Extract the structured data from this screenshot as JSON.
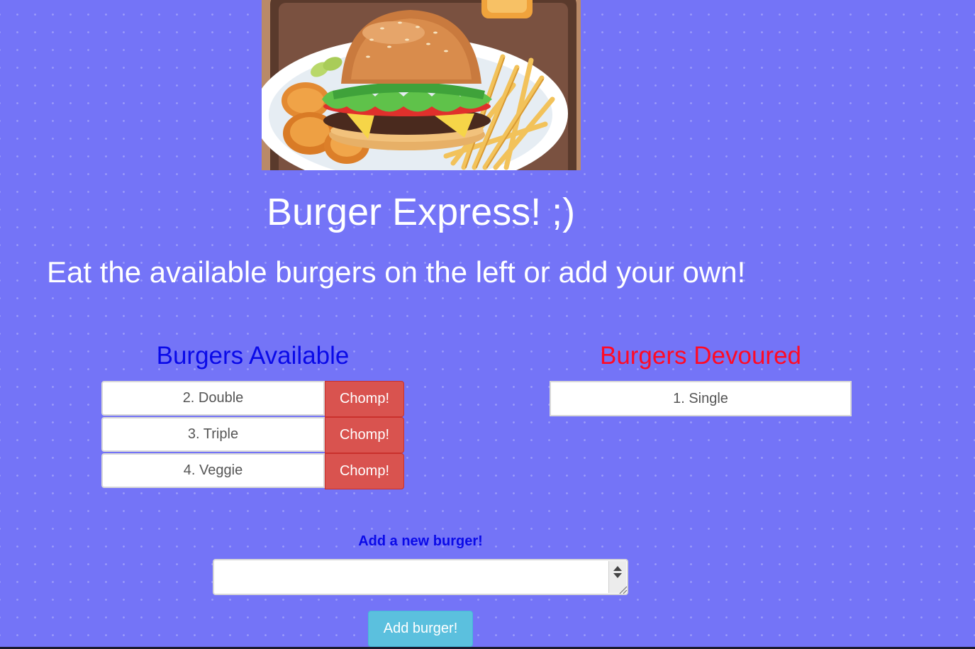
{
  "hero": {
    "image": "burger-meal-illustration"
  },
  "title": "Burger Express! ;)",
  "subtitle": "Eat the available burgers on the left or add your own!",
  "available": {
    "heading": "Burgers Available",
    "heading_color": "#0a0ae8",
    "items": [
      {
        "name": "2. Double",
        "action": "Chomp!"
      },
      {
        "name": "3. Triple",
        "action": "Chomp!"
      },
      {
        "name": "4. Veggie",
        "action": "Chomp!"
      }
    ]
  },
  "devoured": {
    "heading": "Burgers Devoured",
    "heading_color": "#ff0a26",
    "items": [
      {
        "name": "1. Single"
      }
    ]
  },
  "add_form": {
    "label": "Add a new burger!",
    "input_value": "",
    "submit_label": "Add burger!"
  },
  "colors": {
    "background": "#7474f7",
    "chomp_button": "#d9534f",
    "add_button": "#5bc0de"
  }
}
